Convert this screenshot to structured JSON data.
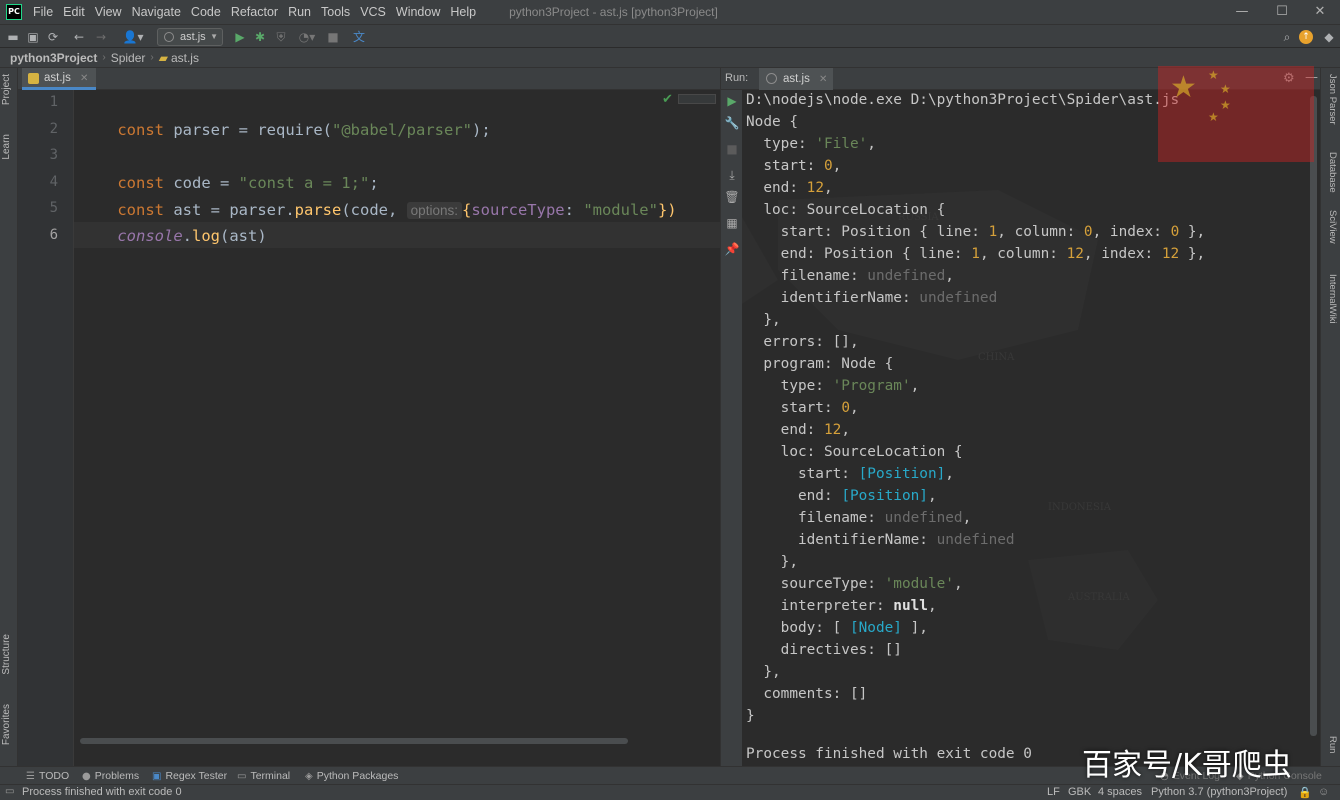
{
  "app": {
    "logo_text": "PC",
    "window_title": "python3Project - ast.js [python3Project]",
    "menu": [
      "File",
      "Edit",
      "View",
      "Navigate",
      "Code",
      "Refactor",
      "Run",
      "Tools",
      "VCS",
      "Window",
      "Help"
    ],
    "window_controls": {
      "minimize": "—",
      "maximize": "☐",
      "close": "✕"
    }
  },
  "toolbar": {
    "run_config": "ast.js"
  },
  "breadcrumb": [
    "python3Project",
    "Spider",
    "ast.js"
  ],
  "left_tool_tabs": [
    "Project",
    "Learn",
    "Structure",
    "Favorites"
  ],
  "right_tool_tabs": [
    "Json Parser",
    "Database",
    "SciView",
    "InternalWiki",
    "Run"
  ],
  "editor": {
    "tab": "ast.js",
    "line_numbers": [
      "1",
      "2",
      "3",
      "4",
      "5",
      "6"
    ],
    "lines": {
      "l1": {
        "kw": "const",
        "rest1": " parser = ",
        "fn": "require",
        "open": "(",
        "str": "\"@babel/parser\"",
        "close": ");"
      },
      "l3": {
        "kw": "const",
        "rest1": " code = ",
        "str": "\"const a = 1;\"",
        "close": ";"
      },
      "l4": {
        "kw": "const",
        "rest1": " ast = parser.",
        "fn": "parse",
        "open": "(code,",
        "hint": "options:",
        "brace_open": "{",
        "key": "sourceType",
        "colon": ": ",
        "str": "\"module\"",
        "close": "})"
      },
      "l5": {
        "global": "console",
        "rest": ".",
        "fn": "log",
        "args": "(ast)"
      }
    }
  },
  "run": {
    "label": "Run:",
    "tab": "ast.js",
    "console": {
      "cmd": "D:\\nodejs\\node.exe D:\\python3Project\\Spider\\ast.js",
      "node_open": "Node {",
      "type_key": "  type: ",
      "type_val": "'File'",
      "comma": ",",
      "start_key": "  start: ",
      "start_val": "0",
      "end_key": "  end: ",
      "end_val": "12",
      "loc_open": "  loc: SourceLocation {",
      "loc_start_a": "    start: Position { line: ",
      "loc_start_line": "1",
      "loc_start_b": ", column: ",
      "loc_start_col": "0",
      "loc_start_c": ", index: ",
      "loc_start_idx": "0",
      "loc_start_d": " },",
      "loc_end_a": "    end: Position { line: ",
      "loc_end_line": "1",
      "loc_end_b": ", column: ",
      "loc_end_col": "12",
      "loc_end_c": ", index: ",
      "loc_end_idx": "12",
      "loc_end_d": " },",
      "filename_key": "    filename: ",
      "undefined": "undefined",
      "identifier_key": "    identifierName: ",
      "loc_close": "  },",
      "errors": "  errors: [],",
      "program_open": "  program: Node {",
      "p_type_key": "    type: ",
      "p_type_val": "'Program'",
      "p_start_key": "    start: ",
      "p_start_val": "0",
      "p_end_key": "    end: ",
      "p_end_val": "12",
      "p_loc_open": "    loc: SourceLocation {",
      "p_loc_start_key": "      start: ",
      "position_ref": "[Position]",
      "p_loc_end_key": "      end: ",
      "p_filename_key": "      filename: ",
      "p_identifier_key": "      identifierName: ",
      "p_loc_close": "    },",
      "source_type_key": "    sourceType: ",
      "source_type_val": "'module'",
      "interpreter_key": "    interpreter: ",
      "null_val": "null",
      "body_key": "    body: [ ",
      "node_ref": "[Node]",
      "body_close": " ],",
      "directives": "    directives: []",
      "program_close": "  },",
      "comments": "  comments: []",
      "node_close": "}",
      "finished": "Process finished with exit code 0"
    }
  },
  "bottom_tabs": [
    "TODO",
    "Problems",
    "Regex Tester",
    "Terminal",
    "Python Packages",
    "Event Log",
    "Python Console"
  ],
  "status": {
    "message": "Process finished with exit code 0",
    "line_sep": "LF",
    "encoding": "GBK",
    "indent": "4 spaces",
    "interpreter": "Python 3.7 (python3Project)"
  },
  "watermark": "百家号/K哥爬虫"
}
